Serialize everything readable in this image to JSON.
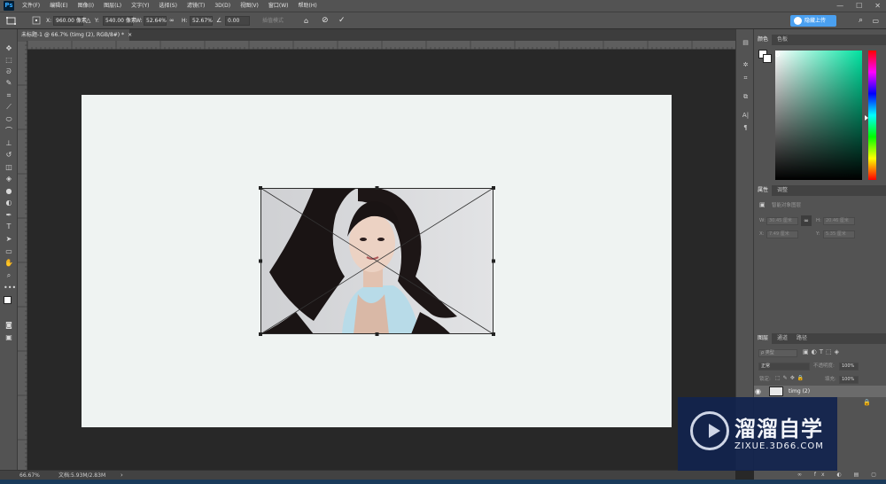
{
  "app": {
    "logo": "Ps"
  },
  "menu": [
    "文件(F)",
    "编辑(E)",
    "图像(I)",
    "图层(L)",
    "文字(Y)",
    "选择(S)",
    "滤镜(T)",
    "3D(D)",
    "视图(V)",
    "窗口(W)",
    "帮助(H)"
  ],
  "window_controls": {
    "minimize": "—",
    "maximize": "☐",
    "close": "✕"
  },
  "options_bar": {
    "x_label": "X:",
    "x_value": "960.00 像素",
    "y_label": "Y:",
    "y_value": "540.00 像素",
    "w_label": "W:",
    "w_value": "52.64%",
    "h_label": "H:",
    "h_value": "52.67%",
    "angle_value": "0.00",
    "interp_label": "插值模式",
    "cloud_button": "隐藏上传"
  },
  "document_tab": {
    "title": "未标题-1 @ 66.7% (timg (2), RGB/8#) *",
    "close": "×"
  },
  "status_bar": {
    "zoom": "66.67%",
    "doc_info": "文档:5.93M/2.83M"
  },
  "panels": {
    "color_tabs": [
      "颜色",
      "色板"
    ],
    "properties_tabs": [
      "属性",
      "调整"
    ],
    "properties_title": "智能对象图层",
    "properties_fields": {
      "w_label": "W:",
      "w_value": "30.45 厘米",
      "h_label": "H:",
      "h_value": "20.46 厘米",
      "x_label": "X:",
      "x_value": "7.49 厘米",
      "y_label": "Y:",
      "y_value": "5.35 厘米"
    },
    "layers_tabs": [
      "图层",
      "通道",
      "路径"
    ],
    "layers_filter": "ρ 类型",
    "blend_mode": "正常",
    "opacity_label": "不透明度:",
    "opacity_value": "100%",
    "lock_label": "锁定:",
    "fill_label": "填充:",
    "fill_value": "100%",
    "layers": [
      {
        "name": "timg (2)",
        "selected": true
      },
      {
        "name": "",
        "selected": false
      }
    ]
  },
  "watermark": {
    "title": "溜溜自学",
    "url": "ZIXUE.3D66.COM"
  },
  "colors": {
    "panel": "#535353",
    "canvas": "#eff3f2",
    "accent": "#4aa0f0",
    "watermark_bg": "#12244e"
  }
}
